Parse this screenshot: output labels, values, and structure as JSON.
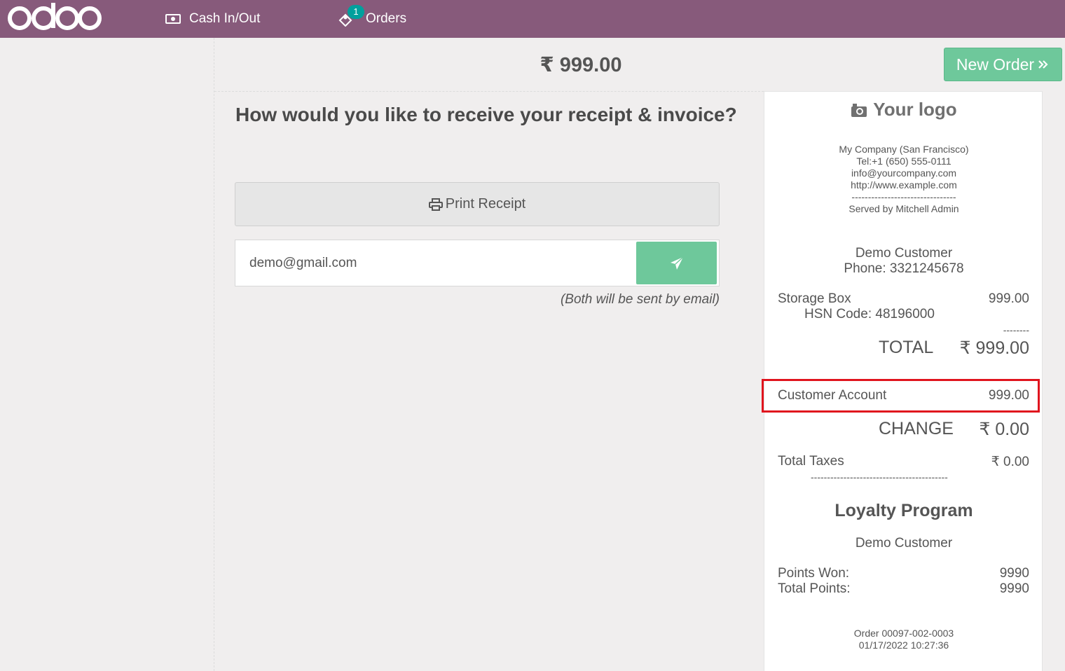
{
  "header": {
    "logo_text": "odoo",
    "cash_label": "Cash In/Out",
    "orders_label": "Orders",
    "orders_badge": "1",
    "color": "#875a7b"
  },
  "payment": {
    "amount": "₹ 999.00",
    "new_order_label": "New Order",
    "question": "How would you like to receive your receipt & invoice?",
    "print_label": "Print Receipt",
    "email_value": "demo@gmail.com",
    "email_note": "(Both will be sent by email)",
    "accent": "#6ec89b"
  },
  "receipt": {
    "logo_placeholder": "Your logo",
    "company_lines": [
      "My Company (San Francisco)",
      "Tel:+1 (650) 555-0111",
      "info@yourcompany.com",
      "http://www.example.com"
    ],
    "company_dash": "--------------------------------",
    "served_by": "Served by Mitchell Admin",
    "customer_name": "Demo Customer",
    "customer_phone": "Phone: 3321245678",
    "item_name": "Storage Box",
    "item_price": "999.00",
    "item_hsn": "HSN Code: 48196000",
    "item_dash": "--------",
    "total_label": "TOTAL",
    "total_value": "₹ 999.00",
    "payment_label": "Customer Account",
    "payment_value": "999.00",
    "change_label": "CHANGE",
    "change_value": "₹ 0.00",
    "taxes_label": "Total Taxes",
    "taxes_value": "₹ 0.00",
    "taxes_dash": "------------------------------------------",
    "loyalty_title": "Loyalty Program",
    "loyalty_customer": "Demo Customer",
    "points_won_label": "Points Won:",
    "points_won_value": "9990",
    "total_points_label": "Total Points:",
    "total_points_value": "9990",
    "order_ref": "Order 00097-002-0003",
    "order_date": "01/17/2022 10:27:36"
  }
}
